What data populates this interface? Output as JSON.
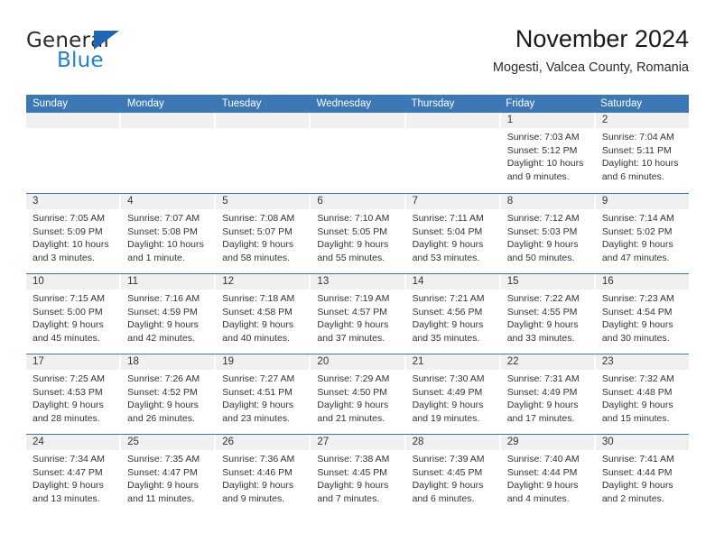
{
  "brand": {
    "name_part1": "General",
    "name_part2": "Blue",
    "accent_color": "#1f7fd4",
    "triangle_color": "#1b67b3"
  },
  "header": {
    "title": "November 2024",
    "subtitle": "Mogesti, Valcea County, Romania"
  },
  "calendar": {
    "header_color": "#3b78b5",
    "daynum_band_color": "#f0f0f0",
    "weekdays": [
      "Sunday",
      "Monday",
      "Tuesday",
      "Wednesday",
      "Thursday",
      "Friday",
      "Saturday"
    ],
    "weeks": [
      [
        {
          "day": "",
          "sunrise": "",
          "sunset": "",
          "daylight_line1": "",
          "daylight_line2": ""
        },
        {
          "day": "",
          "sunrise": "",
          "sunset": "",
          "daylight_line1": "",
          "daylight_line2": ""
        },
        {
          "day": "",
          "sunrise": "",
          "sunset": "",
          "daylight_line1": "",
          "daylight_line2": ""
        },
        {
          "day": "",
          "sunrise": "",
          "sunset": "",
          "daylight_line1": "",
          "daylight_line2": ""
        },
        {
          "day": "",
          "sunrise": "",
          "sunset": "",
          "daylight_line1": "",
          "daylight_line2": ""
        },
        {
          "day": "1",
          "sunrise": "Sunrise: 7:03 AM",
          "sunset": "Sunset: 5:12 PM",
          "daylight_line1": "Daylight: 10 hours",
          "daylight_line2": "and 9 minutes."
        },
        {
          "day": "2",
          "sunrise": "Sunrise: 7:04 AM",
          "sunset": "Sunset: 5:11 PM",
          "daylight_line1": "Daylight: 10 hours",
          "daylight_line2": "and 6 minutes."
        }
      ],
      [
        {
          "day": "3",
          "sunrise": "Sunrise: 7:05 AM",
          "sunset": "Sunset: 5:09 PM",
          "daylight_line1": "Daylight: 10 hours",
          "daylight_line2": "and 3 minutes."
        },
        {
          "day": "4",
          "sunrise": "Sunrise: 7:07 AM",
          "sunset": "Sunset: 5:08 PM",
          "daylight_line1": "Daylight: 10 hours",
          "daylight_line2": "and 1 minute."
        },
        {
          "day": "5",
          "sunrise": "Sunrise: 7:08 AM",
          "sunset": "Sunset: 5:07 PM",
          "daylight_line1": "Daylight: 9 hours",
          "daylight_line2": "and 58 minutes."
        },
        {
          "day": "6",
          "sunrise": "Sunrise: 7:10 AM",
          "sunset": "Sunset: 5:05 PM",
          "daylight_line1": "Daylight: 9 hours",
          "daylight_line2": "and 55 minutes."
        },
        {
          "day": "7",
          "sunrise": "Sunrise: 7:11 AM",
          "sunset": "Sunset: 5:04 PM",
          "daylight_line1": "Daylight: 9 hours",
          "daylight_line2": "and 53 minutes."
        },
        {
          "day": "8",
          "sunrise": "Sunrise: 7:12 AM",
          "sunset": "Sunset: 5:03 PM",
          "daylight_line1": "Daylight: 9 hours",
          "daylight_line2": "and 50 minutes."
        },
        {
          "day": "9",
          "sunrise": "Sunrise: 7:14 AM",
          "sunset": "Sunset: 5:02 PM",
          "daylight_line1": "Daylight: 9 hours",
          "daylight_line2": "and 47 minutes."
        }
      ],
      [
        {
          "day": "10",
          "sunrise": "Sunrise: 7:15 AM",
          "sunset": "Sunset: 5:00 PM",
          "daylight_line1": "Daylight: 9 hours",
          "daylight_line2": "and 45 minutes."
        },
        {
          "day": "11",
          "sunrise": "Sunrise: 7:16 AM",
          "sunset": "Sunset: 4:59 PM",
          "daylight_line1": "Daylight: 9 hours",
          "daylight_line2": "and 42 minutes."
        },
        {
          "day": "12",
          "sunrise": "Sunrise: 7:18 AM",
          "sunset": "Sunset: 4:58 PM",
          "daylight_line1": "Daylight: 9 hours",
          "daylight_line2": "and 40 minutes."
        },
        {
          "day": "13",
          "sunrise": "Sunrise: 7:19 AM",
          "sunset": "Sunset: 4:57 PM",
          "daylight_line1": "Daylight: 9 hours",
          "daylight_line2": "and 37 minutes."
        },
        {
          "day": "14",
          "sunrise": "Sunrise: 7:21 AM",
          "sunset": "Sunset: 4:56 PM",
          "daylight_line1": "Daylight: 9 hours",
          "daylight_line2": "and 35 minutes."
        },
        {
          "day": "15",
          "sunrise": "Sunrise: 7:22 AM",
          "sunset": "Sunset: 4:55 PM",
          "daylight_line1": "Daylight: 9 hours",
          "daylight_line2": "and 33 minutes."
        },
        {
          "day": "16",
          "sunrise": "Sunrise: 7:23 AM",
          "sunset": "Sunset: 4:54 PM",
          "daylight_line1": "Daylight: 9 hours",
          "daylight_line2": "and 30 minutes."
        }
      ],
      [
        {
          "day": "17",
          "sunrise": "Sunrise: 7:25 AM",
          "sunset": "Sunset: 4:53 PM",
          "daylight_line1": "Daylight: 9 hours",
          "daylight_line2": "and 28 minutes."
        },
        {
          "day": "18",
          "sunrise": "Sunrise: 7:26 AM",
          "sunset": "Sunset: 4:52 PM",
          "daylight_line1": "Daylight: 9 hours",
          "daylight_line2": "and 26 minutes."
        },
        {
          "day": "19",
          "sunrise": "Sunrise: 7:27 AM",
          "sunset": "Sunset: 4:51 PM",
          "daylight_line1": "Daylight: 9 hours",
          "daylight_line2": "and 23 minutes."
        },
        {
          "day": "20",
          "sunrise": "Sunrise: 7:29 AM",
          "sunset": "Sunset: 4:50 PM",
          "daylight_line1": "Daylight: 9 hours",
          "daylight_line2": "and 21 minutes."
        },
        {
          "day": "21",
          "sunrise": "Sunrise: 7:30 AM",
          "sunset": "Sunset: 4:49 PM",
          "daylight_line1": "Daylight: 9 hours",
          "daylight_line2": "and 19 minutes."
        },
        {
          "day": "22",
          "sunrise": "Sunrise: 7:31 AM",
          "sunset": "Sunset: 4:49 PM",
          "daylight_line1": "Daylight: 9 hours",
          "daylight_line2": "and 17 minutes."
        },
        {
          "day": "23",
          "sunrise": "Sunrise: 7:32 AM",
          "sunset": "Sunset: 4:48 PM",
          "daylight_line1": "Daylight: 9 hours",
          "daylight_line2": "and 15 minutes."
        }
      ],
      [
        {
          "day": "24",
          "sunrise": "Sunrise: 7:34 AM",
          "sunset": "Sunset: 4:47 PM",
          "daylight_line1": "Daylight: 9 hours",
          "daylight_line2": "and 13 minutes."
        },
        {
          "day": "25",
          "sunrise": "Sunrise: 7:35 AM",
          "sunset": "Sunset: 4:47 PM",
          "daylight_line1": "Daylight: 9 hours",
          "daylight_line2": "and 11 minutes."
        },
        {
          "day": "26",
          "sunrise": "Sunrise: 7:36 AM",
          "sunset": "Sunset: 4:46 PM",
          "daylight_line1": "Daylight: 9 hours",
          "daylight_line2": "and 9 minutes."
        },
        {
          "day": "27",
          "sunrise": "Sunrise: 7:38 AM",
          "sunset": "Sunset: 4:45 PM",
          "daylight_line1": "Daylight: 9 hours",
          "daylight_line2": "and 7 minutes."
        },
        {
          "day": "28",
          "sunrise": "Sunrise: 7:39 AM",
          "sunset": "Sunset: 4:45 PM",
          "daylight_line1": "Daylight: 9 hours",
          "daylight_line2": "and 6 minutes."
        },
        {
          "day": "29",
          "sunrise": "Sunrise: 7:40 AM",
          "sunset": "Sunset: 4:44 PM",
          "daylight_line1": "Daylight: 9 hours",
          "daylight_line2": "and 4 minutes."
        },
        {
          "day": "30",
          "sunrise": "Sunrise: 7:41 AM",
          "sunset": "Sunset: 4:44 PM",
          "daylight_line1": "Daylight: 9 hours",
          "daylight_line2": "and 2 minutes."
        }
      ]
    ]
  }
}
